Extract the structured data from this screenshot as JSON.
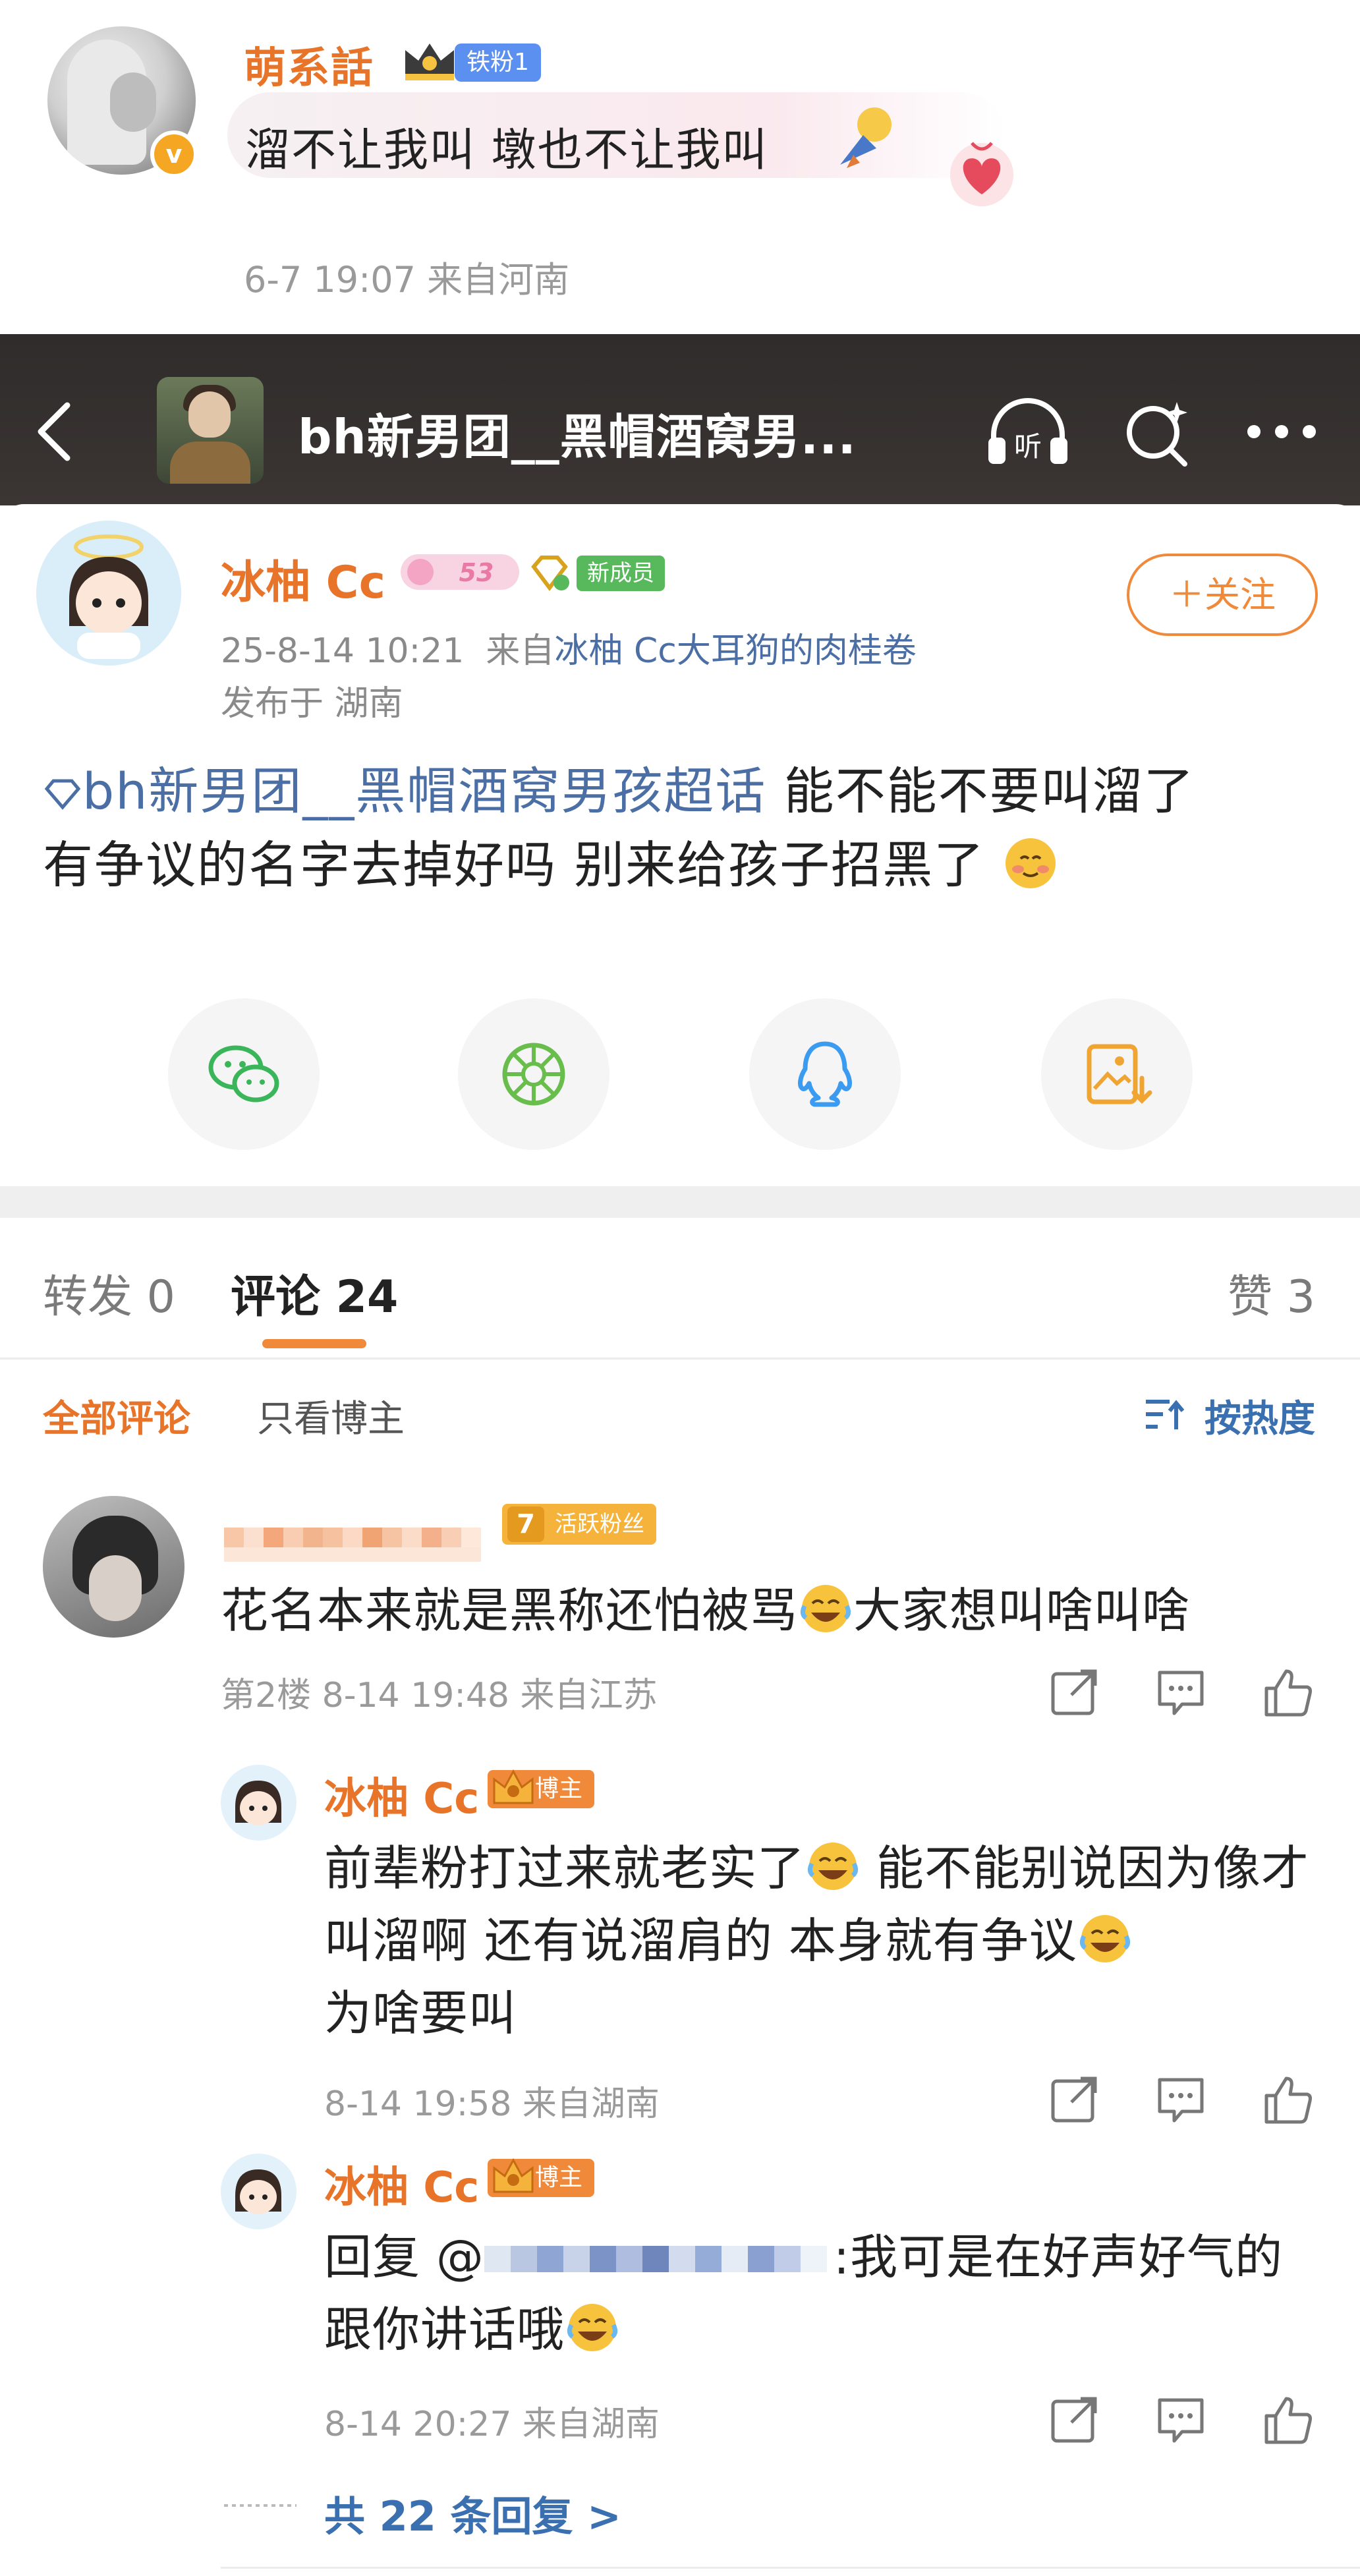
{
  "top_comment": {
    "username": "萌系話",
    "badge": "铁粉1",
    "text": "溜不让我叫 墩也不让我叫",
    "meta": "6-7 19:07 来自河南"
  },
  "header": {
    "title": "bh新男团__黑帽酒窝男..."
  },
  "post": {
    "author": "冰柚 Cc",
    "level": "53",
    "member_badge": "新成员",
    "follow_label": "＋关注",
    "time": "25-8-14 10:21",
    "from_prefix": "来自",
    "source": "冰柚 Cc大耳狗的肉桂卷",
    "location": "发布于 湖南",
    "topic": "bh新男团__黑帽酒窝男孩超话",
    "body_line1": " 能不能不要叫溜了",
    "body_line2": "有争议的名字去掉好吗 别来给孩子招黑了"
  },
  "tabs": {
    "repost": "转发 0",
    "comments": "评论 24",
    "likes": "赞 3"
  },
  "filters": {
    "all": "全部评论",
    "blogger_only": "只看博主",
    "sort": "按热度"
  },
  "comment1": {
    "fan_level": "7",
    "fan_badge": "活跃粉丝",
    "text_a": "花名本来就是黑称还怕被骂",
    "text_b": "大家想叫啥叫啥",
    "meta": "第2楼 8-14 19:48 来自江苏"
  },
  "reply1": {
    "name": "冰柚 Cc",
    "badge": "博主",
    "text_a": "前辈粉打过来就老实了",
    "text_b": " 能不能别说因为像才叫溜啊 还有说溜肩的 本身就有争议",
    "text_c": "为啥要叫",
    "meta": "8-14 19:58 来自湖南"
  },
  "reply2": {
    "name": "冰柚 Cc",
    "badge": "博主",
    "prefix": "回复 @",
    "text_a": ":我可是在好声好气的跟你讲话哦",
    "meta": "8-14 20:27 来自湖南"
  },
  "more_replies": "共 22 条回复 >",
  "icons": {
    "back": "back-arrow-icon",
    "listen": "headphone-icon",
    "search": "search-spark-icon",
    "more": "more-icon",
    "share": [
      "wechat-icon",
      "moments-icon",
      "qq-icon",
      "save-image-icon"
    ],
    "actions": [
      "share-icon",
      "comment-icon",
      "like-icon"
    ]
  },
  "colors": {
    "accent_orange": "#e8742a",
    "link_blue": "#4b6fa5",
    "header_dark": "#2f2c2b",
    "member_green": "#58b85c"
  }
}
